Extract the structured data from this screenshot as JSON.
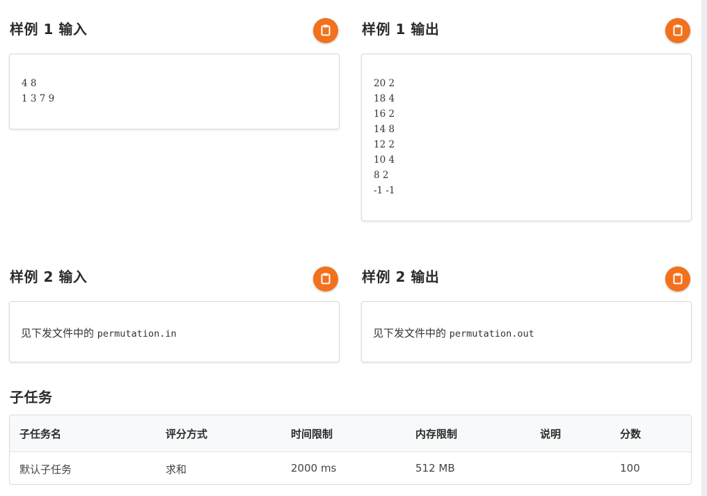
{
  "samples": [
    {
      "title": "样例 1 输入",
      "lines": [
        "4 8",
        "1 3 7 9"
      ]
    },
    {
      "title": "样例 1 输出",
      "lines": [
        "20 2",
        "18 4",
        "16 2",
        "14 8",
        "12 2",
        "10 4",
        "8 2",
        "-1 -1"
      ]
    },
    {
      "title": "样例 2 输入",
      "text": "见下发文件中的",
      "file": "permutation.in"
    },
    {
      "title": "样例 2 输出",
      "text": "见下发文件中的",
      "file": "permutation.out"
    }
  ],
  "copy_icon": "clipboard-icon",
  "accent_color": "#f2711c",
  "subtasks": {
    "title": "子任务",
    "headers": [
      "子任务名",
      "评分方式",
      "时间限制",
      "内存限制",
      "说明",
      "分数"
    ],
    "rows": [
      [
        "默认子任务",
        "求和",
        "2000 ms",
        "512 MB",
        "",
        "100"
      ]
    ]
  }
}
